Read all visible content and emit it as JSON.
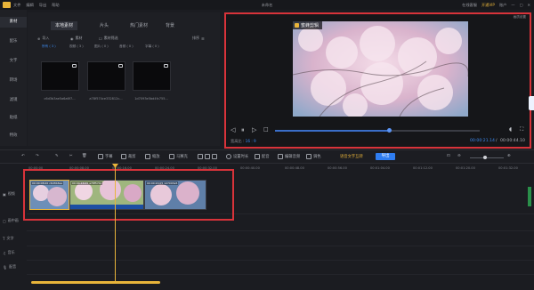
{
  "titlebar": {
    "menus": [
      "文件",
      "编辑",
      "导出",
      "帮助"
    ],
    "title": "未命名",
    "vip": "开通VIP",
    "right": [
      "在线客服",
      "账户"
    ]
  },
  "rail": {
    "items": [
      "素材",
      "配乐",
      "文字",
      "转场",
      "滤镜",
      "贴纸",
      "特效"
    ]
  },
  "panel": {
    "tabs": [
      "本地素材",
      "片头",
      "热门素材",
      "背景"
    ],
    "import_label": "导入",
    "sub_opt1": "素材",
    "sub_opt2": "素材筛选",
    "sort_label": "排序",
    "chips": [
      "所有 ( 3 )",
      "视频 ( 3 )",
      "图片 ( 0 )",
      "音频 ( 0 )",
      "字幕 ( 0 )"
    ],
    "files": [
      "c6d3b3ae5a6a6f7...",
      "a78f574ce332812c...",
      "1d7093e5bd4fc755..."
    ]
  },
  "preview": {
    "watermark": "蜜蜂剪辑",
    "save_prev": "画质设置",
    "ratio_label": "宽高比 :",
    "ratio_value": "16 : 9",
    "time_current": "00:00:21.14",
    "time_sep": "/",
    "time_total": "00:00:44.10"
  },
  "toolbar": {
    "items": [
      "字幕",
      "裁剪",
      "缩放",
      "马赛克",
      "设置时长",
      "配音",
      "倒放",
      "调色"
    ],
    "tools2": [
      "编辑音频"
    ],
    "ai_caption": "语音文字互转",
    "export": "导出"
  },
  "ruler": {
    "ticks": [
      "00:00:00",
      "00:00:08.00",
      "00:00:16.00",
      "00:00:24.00",
      "00:00:32.00",
      "00:00:40.00",
      "00:00:48.00",
      "00:00:56.00",
      "00:01:04.00",
      "00:01:12.00",
      "00:01:20.00",
      "00:01:28.00",
      "00:01:32.00"
    ]
  },
  "tracks": {
    "labels": [
      "视频",
      "画中画",
      "文字",
      "音乐",
      "配音"
    ],
    "clips": [
      "00:00:08.00 c6d3b3ae",
      "00:00:16.05 a78f574c",
      "00:00:20.05 1d7093e5"
    ]
  },
  "colors": {
    "accent": "#e8b43a",
    "blue": "#2f7df0",
    "highlight": "#d8333a"
  }
}
